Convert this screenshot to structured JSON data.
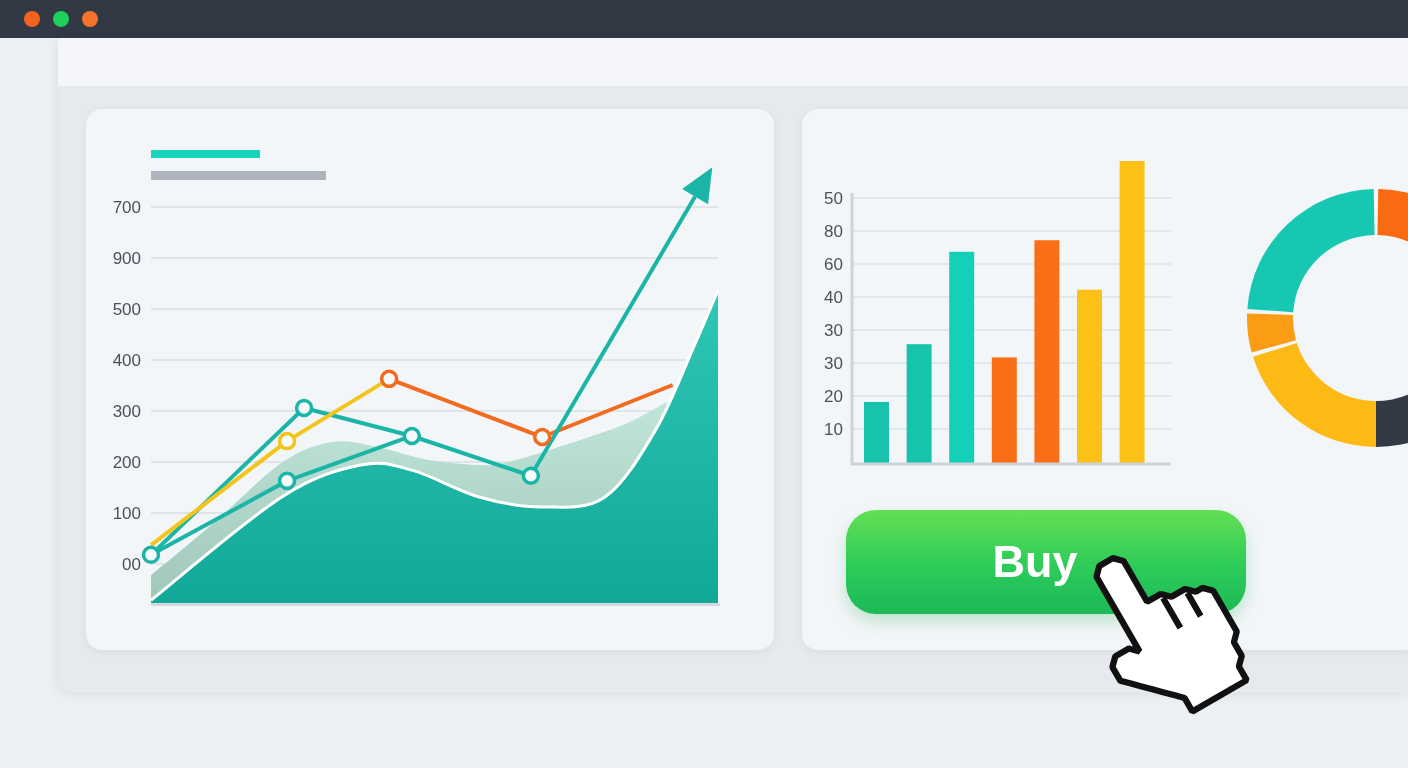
{
  "window": {
    "controls": [
      {
        "color": "#f4621f"
      },
      {
        "color": "#1fcf5b"
      },
      {
        "color": "#f5742c"
      }
    ]
  },
  "line_chart": {
    "y_axis_labels": [
      "700",
      "900",
      "500",
      "400",
      "300",
      "200",
      "100",
      "00"
    ]
  },
  "bar_chart": {
    "y_axis_labels": [
      "50",
      "80",
      "60",
      "40",
      "30",
      "30",
      "20",
      "10"
    ]
  },
  "buy_button": {
    "label": "Buy"
  }
}
